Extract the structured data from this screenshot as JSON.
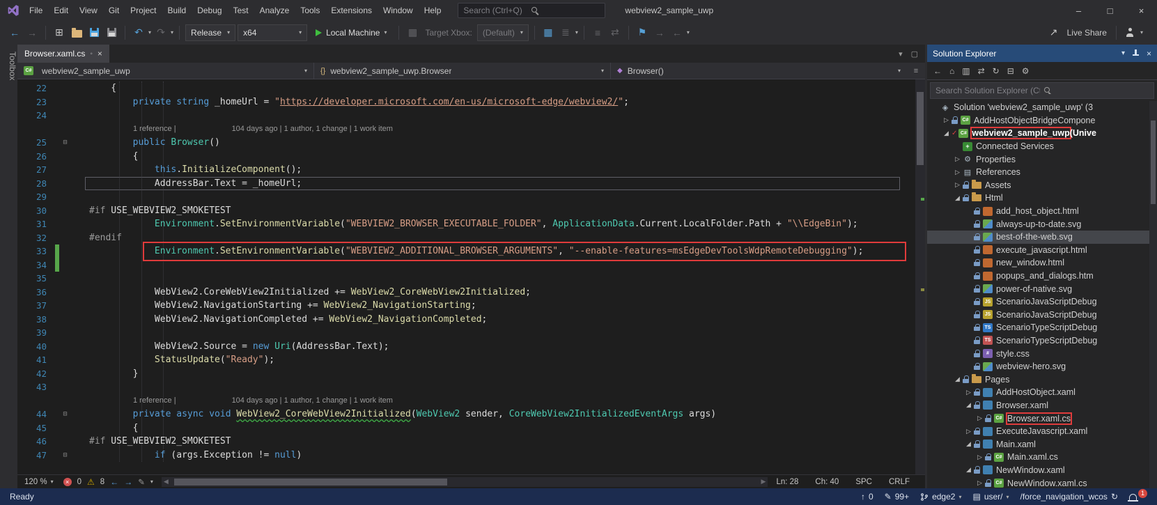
{
  "icons": {
    "back": "←",
    "forward": "→",
    "new_project": "⊞",
    "undo": "↶",
    "redo": "↷",
    "caret": "▾",
    "target": "▦",
    "monitor": "▦",
    "list": "≣",
    "align": "≡",
    "swap": "⇄",
    "bookmark": "⚑",
    "live_share": "↗",
    "minimize": "–",
    "maximize": "□",
    "close": "×",
    "tab_state": "◦",
    "tab_list": "▾",
    "float": "▢",
    "nav_more": "≡",
    "breadcrumb_class": "{}",
    "breadcrumb_method": "◆",
    "error_x": "×",
    "warning": "⚠",
    "nav_back": "←",
    "nav_fwd": "→",
    "pencil": "✎",
    "scroll_left": "◀",
    "scroll_right": "▶",
    "fold": "⊟",
    "collapsed": "▷",
    "expanded": "◢",
    "check": "✓",
    "se_back": "←",
    "se_home": "⌂",
    "se_files": "▥",
    "se_sync": "⇄",
    "se_refresh": "↻",
    "se_collapse": "⊟",
    "se_props": "⚙",
    "up_arrow": "↑",
    "repo": "▤",
    "refresh": "↻",
    "chevron": "▾"
  },
  "titlebar": {
    "menus": [
      "File",
      "Edit",
      "View",
      "Git",
      "Project",
      "Build",
      "Debug",
      "Test",
      "Analyze",
      "Tools",
      "Extensions",
      "Window",
      "Help"
    ],
    "search_placeholder": "Search (Ctrl+Q)",
    "window_title": "webview2_sample_uwp"
  },
  "toolbar": {
    "configuration": "Release",
    "platform": "x64",
    "start_button": "Local Machine",
    "target_label": "Target Xbox:",
    "target_value": "(Default)",
    "live_share": "Live Share"
  },
  "toolbox_label": "Toolbox",
  "editor": {
    "tab_title": "Browser.xaml.cs",
    "nav": [
      "webview2_sample_uwp",
      "webview2_sample_uwp.Browser",
      "Browser()"
    ],
    "codelens": {
      "references": "1 reference |",
      "history": "104 days ago | 1 author, 1 change | 1 work item"
    },
    "rows": [
      {
        "n": "22",
        "tokens": [
          [
            "p",
            "    {"
          ]
        ]
      },
      {
        "n": "23",
        "tokens": [
          [
            "p",
            "        "
          ],
          [
            "k",
            "private"
          ],
          [
            "p",
            " "
          ],
          [
            "k",
            "string"
          ],
          [
            "p",
            " "
          ],
          [
            "p",
            "_homeUrl"
          ],
          [
            "p",
            " = "
          ],
          [
            "s",
            "\""
          ],
          [
            "su",
            "https://developer.microsoft.com/en-us/microsoft-edge/webview2/"
          ],
          [
            "s",
            "\""
          ],
          [
            "p",
            ";"
          ]
        ]
      },
      {
        "n": "24",
        "tokens": []
      },
      {
        "lens": true
      },
      {
        "n": "25",
        "fold": true,
        "tokens": [
          [
            "p",
            "        "
          ],
          [
            "k",
            "public"
          ],
          [
            "p",
            " "
          ],
          [
            "t",
            "Browser"
          ],
          [
            "p",
            "()"
          ]
        ]
      },
      {
        "n": "26",
        "tokens": [
          [
            "p",
            "        {"
          ]
        ]
      },
      {
        "n": "27",
        "tokens": [
          [
            "p",
            "            "
          ],
          [
            "k",
            "this"
          ],
          [
            "p",
            "."
          ],
          [
            "m",
            "InitializeComponent"
          ],
          [
            "p",
            "();"
          ]
        ]
      },
      {
        "n": "28",
        "cur": true,
        "tokens": [
          [
            "p",
            "            AddressBar.Text = _homeUrl;"
          ]
        ]
      },
      {
        "n": "29",
        "tokens": []
      },
      {
        "n": "30",
        "tokens": [
          [
            "ppk",
            "#if"
          ],
          [
            "p",
            " USE_WEBVIEW2_SMOKETEST"
          ]
        ]
      },
      {
        "n": "31",
        "tokens": [
          [
            "p",
            "            "
          ],
          [
            "t",
            "Environment"
          ],
          [
            "p",
            "."
          ],
          [
            "m",
            "SetEnvironmentVariable"
          ],
          [
            "p",
            "("
          ],
          [
            "s",
            "\"WEBVIEW2_BROWSER_EXECUTABLE_FOLDER\""
          ],
          [
            "p",
            ", "
          ],
          [
            "t",
            "ApplicationData"
          ],
          [
            "p",
            ".Current.LocalFolder.Path + "
          ],
          [
            "s",
            "\"\\\\EdgeBin\""
          ],
          [
            "p",
            ");"
          ]
        ]
      },
      {
        "n": "32",
        "tokens": [
          [
            "ppk",
            "#endif"
          ]
        ]
      },
      {
        "n": "33",
        "red": true,
        "chg": true,
        "tokens": [
          [
            "p",
            "            "
          ],
          [
            "t",
            "Environment"
          ],
          [
            "p",
            "."
          ],
          [
            "m",
            "SetEnvironmentVariable"
          ],
          [
            "p",
            "("
          ],
          [
            "s",
            "\"WEBVIEW2_ADDITIONAL_BROWSER_ARGUMENTS\""
          ],
          [
            "p",
            ", "
          ],
          [
            "s",
            "\"--enable-features=msEdgeDevToolsWdpRemoteDebugging\""
          ],
          [
            "p",
            ");"
          ]
        ]
      },
      {
        "n": "34",
        "chg": true,
        "tokens": []
      },
      {
        "n": "35",
        "tokens": []
      },
      {
        "n": "36",
        "tokens": [
          [
            "p",
            "            WebView2.CoreWebView2Initialized += "
          ],
          [
            "m",
            "WebView2_CoreWebView2Initialized"
          ],
          [
            "p",
            ";"
          ]
        ]
      },
      {
        "n": "37",
        "tokens": [
          [
            "p",
            "            WebView2.NavigationStarting += "
          ],
          [
            "m",
            "WebView2_NavigationStarting"
          ],
          [
            "p",
            ";"
          ]
        ]
      },
      {
        "n": "38",
        "tokens": [
          [
            "p",
            "            WebView2.NavigationCompleted += "
          ],
          [
            "m",
            "WebView2_NavigationCompleted"
          ],
          [
            "p",
            ";"
          ]
        ]
      },
      {
        "n": "39",
        "tokens": []
      },
      {
        "n": "40",
        "tokens": [
          [
            "p",
            "            WebView2.Source = "
          ],
          [
            "k",
            "new"
          ],
          [
            "p",
            " "
          ],
          [
            "t",
            "Uri"
          ],
          [
            "p",
            "(AddressBar.Text);"
          ]
        ]
      },
      {
        "n": "41",
        "tokens": [
          [
            "p",
            "            "
          ],
          [
            "m",
            "StatusUpdate"
          ],
          [
            "p",
            "("
          ],
          [
            "s",
            "\"Ready\""
          ],
          [
            "p",
            ");"
          ]
        ]
      },
      {
        "n": "42",
        "tokens": [
          [
            "p",
            "        }"
          ]
        ]
      },
      {
        "n": "43",
        "tokens": []
      },
      {
        "lens": true
      },
      {
        "n": "44",
        "fold": true,
        "tokens": [
          [
            "p",
            "        "
          ],
          [
            "k",
            "private"
          ],
          [
            "p",
            " "
          ],
          [
            "k",
            "async"
          ],
          [
            "p",
            " "
          ],
          [
            "k",
            "void"
          ],
          [
            "p",
            " "
          ],
          [
            "mw",
            "WebView2_CoreWebView2Initialized"
          ],
          [
            "p",
            "("
          ],
          [
            "t",
            "WebView2"
          ],
          [
            "p",
            " sender, "
          ],
          [
            "t",
            "CoreWebView2InitializedEventArgs"
          ],
          [
            "p",
            " args)"
          ]
        ]
      },
      {
        "n": "45",
        "tokens": [
          [
            "p",
            "        {"
          ]
        ]
      },
      {
        "n": "46",
        "tokens": [
          [
            "ppk",
            "#if"
          ],
          [
            "p",
            " USE_WEBVIEW2_SMOKETEST"
          ]
        ]
      },
      {
        "n": "47",
        "fold": true,
        "tokens": [
          [
            "p",
            "            "
          ],
          [
            "k",
            "if"
          ],
          [
            "p",
            " (args.Exception != "
          ],
          [
            "k",
            "null"
          ],
          [
            "p",
            ")"
          ]
        ]
      }
    ],
    "status": {
      "zoom": "120 %",
      "errors": "0",
      "warnings": "8",
      "line": "Ln: 28",
      "column": "Ch: 40",
      "spaces": "SPC",
      "line_ending": "CRLF"
    }
  },
  "solution_explorer": {
    "title": "Solution Explorer",
    "search_placeholder": "Search Solution Explorer (Ctrl+;)",
    "tree": [
      {
        "label": "Solution 'webview2_sample_uwp' (3",
        "depth": 0,
        "icon": "solution-icon",
        "badge": "◈",
        "arrow": ""
      },
      {
        "label": "AddHostObjectBridgeCompone",
        "depth": 1,
        "icon": "csharp-project-icon",
        "badge": "C#",
        "arrow": "collapsed",
        "lock": true
      },
      {
        "label": "webview2_sample_uwp",
        "suffix": " (Unive",
        "depth": 1,
        "icon": "csharp-project-icon",
        "badge": "C#",
        "arrow": "expanded",
        "bold": true,
        "redbox": true,
        "check": true
      },
      {
        "label": "Connected Services",
        "depth": 2,
        "icon": "connected-services-icon",
        "badge": "+",
        "arrow": ""
      },
      {
        "label": "Properties",
        "depth": 2,
        "icon": "properties-icon",
        "badge": "⚙",
        "arrow": "collapsed"
      },
      {
        "label": "References",
        "depth": 2,
        "icon": "references-icon",
        "badge": "▤",
        "arrow": "collapsed"
      },
      {
        "label": "Assets",
        "depth": 2,
        "icon": "folder-icon",
        "badge": "",
        "arrow": "collapsed",
        "lock": true
      },
      {
        "label": "Html",
        "depth": 2,
        "icon": "folder-icon",
        "badge": "",
        "arrow": "expanded",
        "lock": true
      },
      {
        "label": "add_host_object.html",
        "depth": 3,
        "icon": "html-file-icon",
        "badge": "",
        "lock": true
      },
      {
        "label": "always-up-to-date.svg",
        "depth": 3,
        "icon": "svg-file-icon",
        "badge": "",
        "lock": true
      },
      {
        "label": "best-of-the-web.svg",
        "depth": 3,
        "icon": "svg-file-icon",
        "badge": "",
        "lock": true,
        "selected": true
      },
      {
        "label": "execute_javascript.html",
        "depth": 3,
        "icon": "html-file-icon",
        "badge": "",
        "lock": true
      },
      {
        "label": "new_window.html",
        "depth": 3,
        "icon": "html-file-icon",
        "badge": "",
        "lock": true
      },
      {
        "label": "popups_and_dialogs.htm",
        "depth": 3,
        "icon": "html-file-icon",
        "badge": "",
        "lock": true
      },
      {
        "label": "power-of-native.svg",
        "depth": 3,
        "icon": "svg-file-icon",
        "badge": "",
        "lock": true
      },
      {
        "label": "ScenarioJavaScriptDebug",
        "depth": 3,
        "icon": "js-file-icon",
        "badge": "JS",
        "lock": true
      },
      {
        "label": "ScenarioJavaScriptDebug",
        "depth": 3,
        "icon": "js-file-icon",
        "badge": "JS",
        "lock": true
      },
      {
        "label": "ScenarioTypeScriptDebug",
        "depth": 3,
        "icon": "ts-file-icon",
        "badge": "TS",
        "lock": true
      },
      {
        "label": "ScenarioTypeScriptDebug",
        "depth": 3,
        "icon": "ts-red-file-icon",
        "badge": "TS",
        "lock": true
      },
      {
        "label": "style.css",
        "depth": 3,
        "icon": "css-file-icon",
        "badge": "#",
        "lock": true
      },
      {
        "label": "webview-hero.svg",
        "depth": 3,
        "icon": "svg-file-icon",
        "badge": "",
        "lock": true
      },
      {
        "label": "Pages",
        "depth": 2,
        "icon": "folder-icon",
        "badge": "",
        "arrow": "expanded",
        "lock": true
      },
      {
        "label": "AddHostObject.xaml",
        "depth": 3,
        "icon": "xaml-file-icon",
        "badge": "",
        "arrow": "collapsed",
        "lock": true
      },
      {
        "label": "Browser.xaml",
        "depth": 3,
        "icon": "xaml-file-icon",
        "badge": "",
        "arrow": "expanded",
        "lock": true
      },
      {
        "label": "Browser.xaml.cs",
        "depth": 4,
        "icon": "cs-file-icon",
        "badge": "C#",
        "arrow": "collapsed",
        "lock": true,
        "redbox": true
      },
      {
        "label": "ExecuteJavascript.xaml",
        "depth": 3,
        "icon": "xaml-file-icon",
        "badge": "",
        "arrow": "collapsed",
        "lock": true
      },
      {
        "label": "Main.xaml",
        "depth": 3,
        "icon": "xaml-file-icon",
        "badge": "",
        "arrow": "expanded",
        "lock": true
      },
      {
        "label": "Main.xaml.cs",
        "depth": 4,
        "icon": "cs-file-icon",
        "badge": "C#",
        "arrow": "collapsed",
        "lock": true
      },
      {
        "label": "NewWindow.xaml",
        "depth": 3,
        "icon": "xaml-file-icon",
        "badge": "",
        "arrow": "expanded",
        "lock": true
      },
      {
        "label": "NewWindow.xaml.cs",
        "depth": 4,
        "icon": "cs-file-icon",
        "badge": "C#",
        "arrow": "collapsed",
        "lock": true
      }
    ]
  },
  "statusbar": {
    "ready": "Ready",
    "outgoing_commits": "0",
    "pending_changes": "99+",
    "branch": "edge2",
    "repo": "user/",
    "work_item": "/force_navigation_wcos",
    "bell_badge": "1"
  }
}
